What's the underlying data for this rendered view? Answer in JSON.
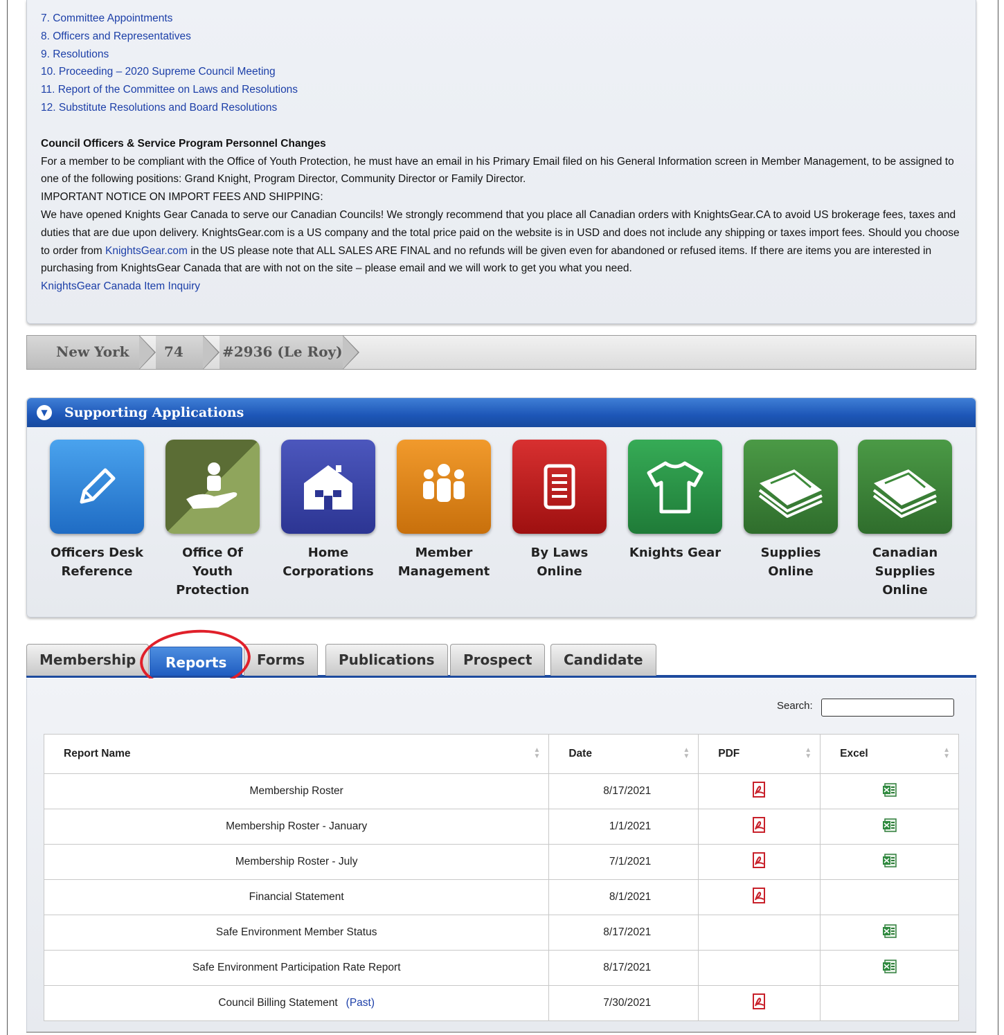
{
  "notice": {
    "items": [
      "7. Committee Appointments",
      "8. Officers and Representatives",
      "9. Resolutions",
      "10. Proceeding – 2020 Supreme Council Meeting",
      "11. Report of the Committee on Laws and Resolutions",
      "12. Substitute Resolutions and Board Resolutions"
    ],
    "heading": "Council Officers & Service Program Personnel Changes",
    "para1": "For a member to be compliant with the Office of Youth Protection, he must have an email in his Primary Email filed on his General Information screen in Member Management, to be assigned to one of the following positions: Grand Knight, Program Director, Community Director or Family Director.",
    "important": "IMPORTANT NOTICE ON IMPORT FEES AND SHIPPING:",
    "para2_before": "We have opened Knights Gear Canada to serve our Canadian Councils! We strongly recommend that you place all Canadian orders with KnightsGear.CA to avoid US brokerage fees, taxes and duties that are due upon delivery. KnightsGear.com is a US company and the total price paid on the website is in USD and does not include any shipping or taxes import fees. Should you choose to order from ",
    "para2_link": "KnightsGear.com",
    "para2_after": " in the US please note that ALL SALES ARE FINAL and no refunds will be given even for abandoned or refused items. If there are items you are interested in purchasing from KnightsGear Canada that are with not on the site – please email and we will work to get you what you need.",
    "inquiry_link": "KnightsGear Canada Item Inquiry"
  },
  "breadcrumb": [
    "New York",
    "74",
    "#2936 (Le Roy)"
  ],
  "apps": {
    "title": "Supporting Applications",
    "tiles": [
      {
        "label_lines": [
          "Officers Desk",
          "Reference"
        ],
        "icon": "pencil-icon",
        "color": "#2f86d6"
      },
      {
        "label_lines": [
          "Office Of Youth",
          "Protection"
        ],
        "icon": "youth-protection-icon",
        "color": "#6b8a3e"
      },
      {
        "label_lines": [
          "Home",
          "Corporations"
        ],
        "icon": "house-icon",
        "color": "#3b47a8"
      },
      {
        "label_lines": [
          "Member",
          "Management"
        ],
        "icon": "people-icon",
        "color": "#e0861c"
      },
      {
        "label_lines": [
          "By Laws",
          "Online"
        ],
        "icon": "document-icon",
        "color": "#c21e1e"
      },
      {
        "label_lines": [
          "Knights Gear"
        ],
        "icon": "tshirt-icon",
        "color": "#2f9a4a"
      },
      {
        "label_lines": [
          "Supplies",
          "Online"
        ],
        "icon": "papers-icon",
        "color": "#3d8a3a"
      },
      {
        "label_lines": [
          "Canadian",
          "Supplies",
          "Online"
        ],
        "icon": "papers-icon",
        "color": "#3d8a3a"
      }
    ]
  },
  "tabs": [
    "Membership",
    "Reports",
    "Forms",
    "Publications",
    "Prospect",
    "Candidate"
  ],
  "active_tab": "Reports",
  "search": {
    "label": "Search:",
    "value": ""
  },
  "table": {
    "headers": [
      "Report Name",
      "Date",
      "PDF",
      "Excel"
    ],
    "rows": [
      {
        "name": "Membership Roster",
        "date": "8/17/2021",
        "pdf": true,
        "excel": true
      },
      {
        "name": "Membership Roster - January",
        "date": "1/1/2021",
        "pdf": true,
        "excel": true
      },
      {
        "name": "Membership Roster - July",
        "date": "7/1/2021",
        "pdf": true,
        "excel": true
      },
      {
        "name": "Financial Statement",
        "date": "8/1/2021",
        "pdf": true,
        "excel": false
      },
      {
        "name": "Safe Environment Member Status",
        "date": "8/17/2021",
        "pdf": false,
        "excel": true
      },
      {
        "name": "Safe Environment Participation Rate Report",
        "date": "8/17/2021",
        "pdf": false,
        "excel": true
      },
      {
        "name": "Council Billing Statement",
        "link": "(Past)",
        "date": "7/30/2021",
        "pdf": true,
        "excel": false
      }
    ]
  }
}
